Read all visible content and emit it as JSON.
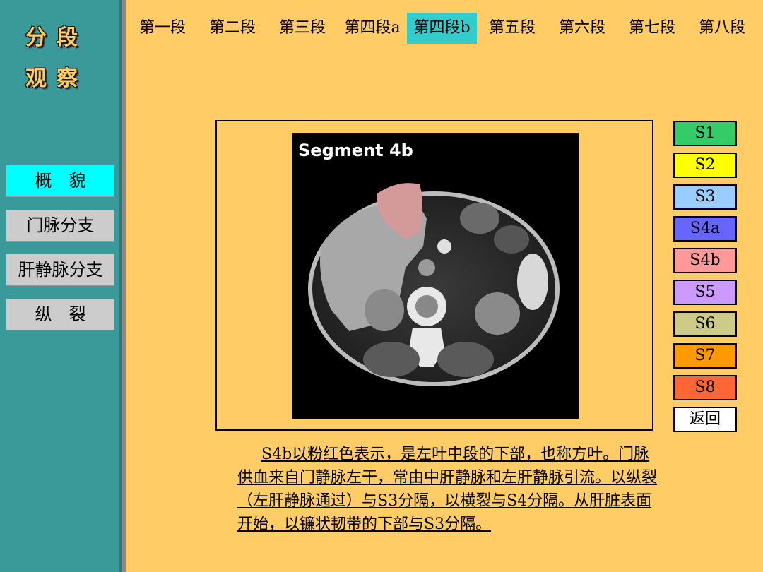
{
  "logo": {
    "line1": "分段",
    "line2": "观察"
  },
  "sidebar": {
    "items": [
      {
        "label": "概　貌",
        "active": true
      },
      {
        "label": "门脉分支",
        "active": false
      },
      {
        "label": "肝静脉分支",
        "active": false
      },
      {
        "label": "纵　裂",
        "active": false
      }
    ]
  },
  "tabs": [
    {
      "label": "第一段"
    },
    {
      "label": "第二段"
    },
    {
      "label": "第三段"
    },
    {
      "label": "第四段a"
    },
    {
      "label": "第四段b",
      "active": true
    },
    {
      "label": "第五段"
    },
    {
      "label": "第六段"
    },
    {
      "label": "第七段"
    },
    {
      "label": "第八段"
    }
  ],
  "image": {
    "title": "Segment 4b"
  },
  "segments": [
    {
      "label": "S1",
      "color": "#33cc66"
    },
    {
      "label": "S2",
      "color": "#ffff00"
    },
    {
      "label": "S3",
      "color": "#99ccff"
    },
    {
      "label": "S4a",
      "color": "#6666ff"
    },
    {
      "label": "S4b",
      "color": "#ff9999"
    },
    {
      "label": "S5",
      "color": "#cc99ff"
    },
    {
      "label": "S6",
      "color": "#cccc88"
    },
    {
      "label": "S7",
      "color": "#ff9900"
    },
    {
      "label": "S8",
      "color": "#ff6633"
    },
    {
      "label": "返回",
      "color": "#ffffff"
    }
  ],
  "description": "S4b以粉红色表示，是左叶中段的下部，也称方叶。门脉供血来自门静脉左干，常由中肝静脉和左肝静脉引流。以纵裂（左肝静脉通过）与S3分隔，以横裂与S4分隔。从肝脏表面开始，以镰状韧带的下部与S3分隔。"
}
